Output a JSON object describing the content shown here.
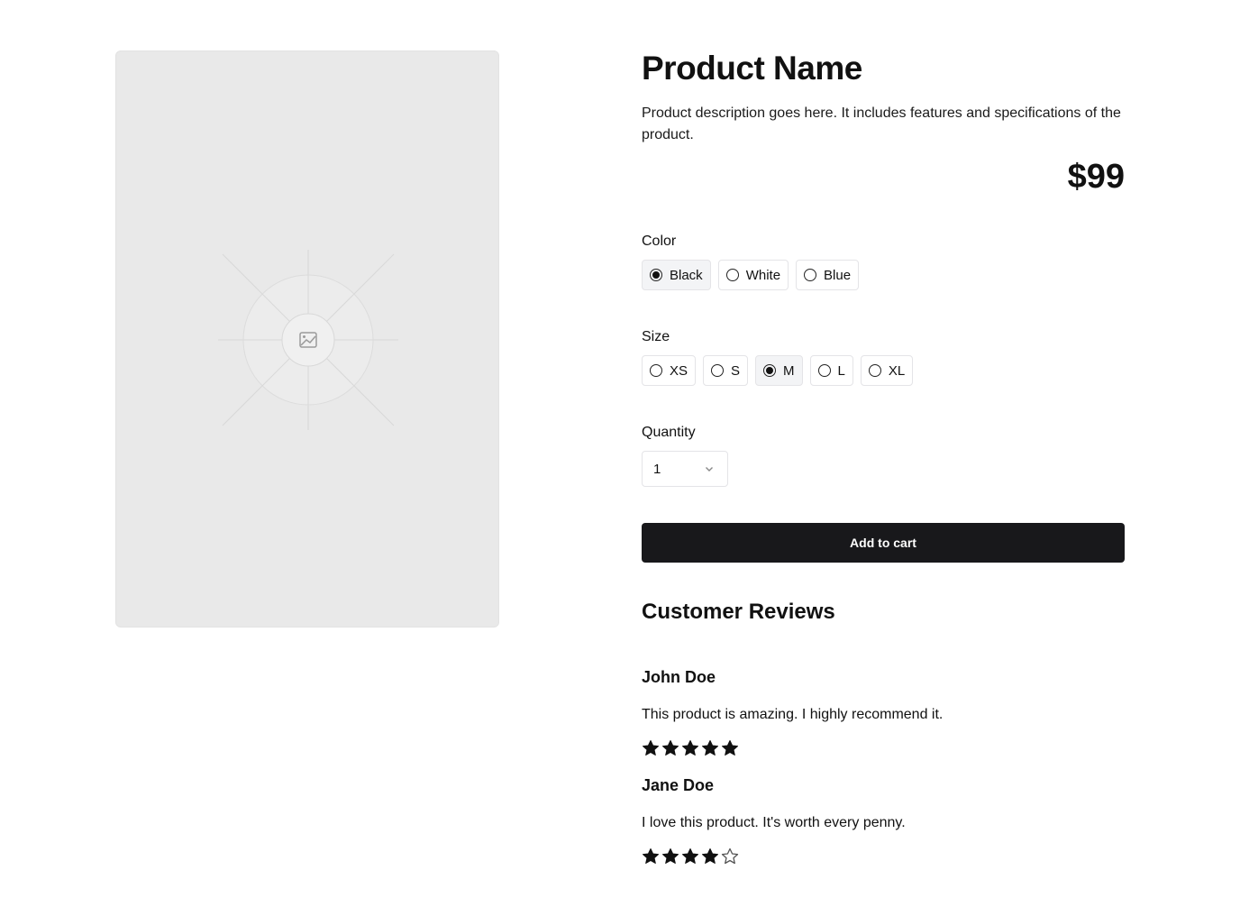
{
  "product": {
    "name": "Product Name",
    "description": "Product description goes here. It includes features and specifications of the product.",
    "price": "$99",
    "image_icon": "image-placeholder-icon"
  },
  "color": {
    "label": "Color",
    "options": [
      "Black",
      "White",
      "Blue"
    ],
    "selected": "Black"
  },
  "size": {
    "label": "Size",
    "options": [
      "XS",
      "S",
      "M",
      "L",
      "XL"
    ],
    "selected": "M"
  },
  "quantity": {
    "label": "Quantity",
    "value": "1",
    "icon": "chevron-down-icon"
  },
  "cart": {
    "button_label": "Add to cart"
  },
  "reviews": {
    "title": "Customer Reviews",
    "items": [
      {
        "name": "John Doe",
        "text": "This product is amazing. I highly recommend it.",
        "rating": 5,
        "max": 5
      },
      {
        "name": "Jane Doe",
        "text": "I love this product. It's worth every penny.",
        "rating": 4,
        "max": 5
      }
    ]
  },
  "colors": {
    "button": "#18181b",
    "image_bg": "#e9e9e9",
    "selected_bg": "#f3f4f6"
  }
}
